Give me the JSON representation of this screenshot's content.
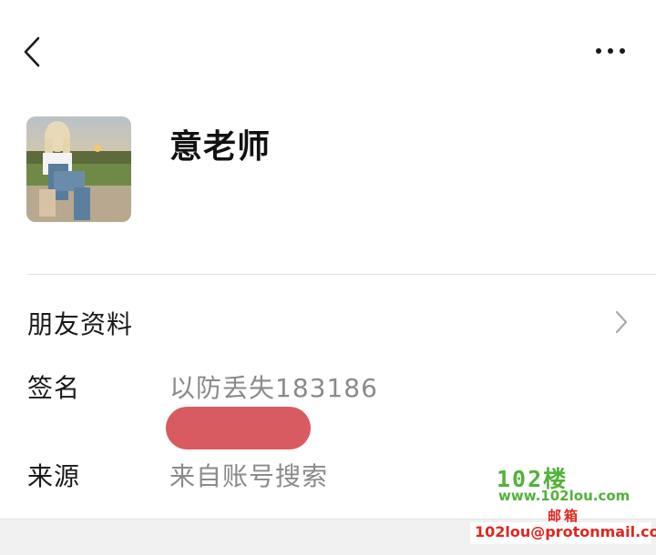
{
  "header": {
    "back_icon": "chevron-left-icon",
    "more_icon": "more-horizontal-icon"
  },
  "profile": {
    "name": "意老师",
    "avatar_icon": "avatar"
  },
  "friend_info": {
    "label": "朋友资料",
    "chevron_icon": "chevron-right-icon"
  },
  "signature": {
    "label": "签名",
    "value": "以防丢失183186"
  },
  "source": {
    "label": "来源",
    "value": "来自账号搜索"
  },
  "watermark": {
    "logo": "102楼",
    "url": "www.102lou.com",
    "mail_label": "邮箱",
    "email": "102lou@protonmail.com"
  },
  "colors": {
    "redaction": "#d95b62",
    "watermark_green": "#52b23a",
    "watermark_red": "#e0261f"
  }
}
